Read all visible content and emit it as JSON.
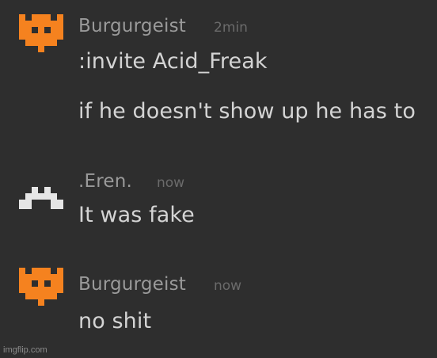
{
  "messages": [
    {
      "username": "Burgurgeist",
      "time": "2min",
      "avatar": "orange-pixel-crown-icon",
      "lines": [
        ":invite Acid_Freak",
        "if he doesn't show up he has to"
      ]
    },
    {
      "username": ".Eren.",
      "time": "now",
      "avatar": "white-pixel-avatar-icon",
      "lines": [
        "It was fake"
      ]
    },
    {
      "username": "Burgurgeist",
      "time": "now",
      "avatar": "orange-pixel-crown-icon",
      "lines": [
        "no shit"
      ]
    }
  ],
  "watermark": "imgflip.com",
  "colors": {
    "background": "#2e2e2e",
    "username": "#9a9a9a",
    "timestamp": "#6b6b6b",
    "message_text": "#d4d4d4",
    "orange_avatar": "#f5821f",
    "white_avatar": "#e6e6e6"
  }
}
